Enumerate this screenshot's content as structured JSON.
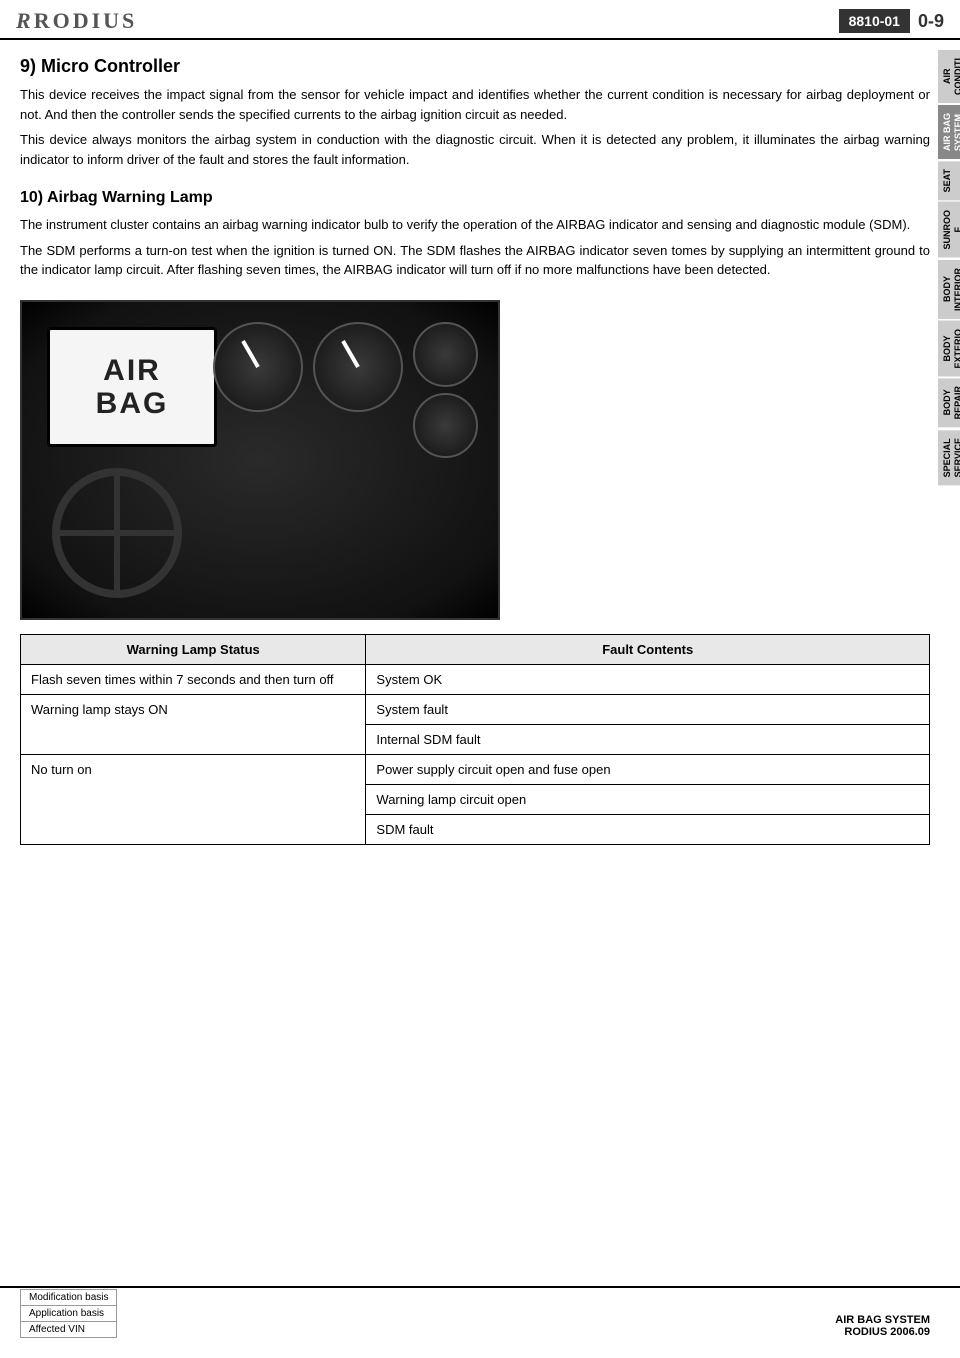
{
  "header": {
    "logo": "RODIUS",
    "page_code": "8810-01",
    "page_num": "0-9"
  },
  "sidebar": {
    "tabs": [
      {
        "id": "air-condio",
        "label": "AIR\nCONDITIO",
        "active": false
      },
      {
        "id": "air-bag",
        "label": "AIR BAG\nSYSTEM",
        "active": true
      },
      {
        "id": "seat",
        "label": "SEAT",
        "active": false
      },
      {
        "id": "sunroof",
        "label": "SUNROO\nF",
        "active": false
      },
      {
        "id": "body-interior",
        "label": "BODY\nINTERIOR",
        "active": false
      },
      {
        "id": "body-exterior",
        "label": "BODY\nEXTERIO",
        "active": false
      },
      {
        "id": "body-repair",
        "label": "BODY\nREPAIR",
        "active": false
      },
      {
        "id": "special-service",
        "label": "SPECIAL\nSERVICE",
        "active": false
      }
    ]
  },
  "sections": {
    "micro_controller": {
      "heading": "9) Micro Controller",
      "paragraphs": [
        "This device receives the impact signal from the sensor for vehicle impact and identifies whether the current condition is necessary for airbag deployment or not. And then the controller sends the specified currents to the airbag ignition circuit as needed.",
        "This device always monitors the airbag system in conduction with the diagnostic circuit. When it is detected any problem, it illuminates the airbag warning indicator to inform driver of the fault and stores the fault information."
      ]
    },
    "warning_lamp": {
      "heading": "10) Airbag Warning Lamp",
      "paragraphs": [
        "The instrument cluster contains an airbag warning indicator bulb to verify the operation of the AIRBAG indicator and sensing and diagnostic module (SDM).",
        "The SDM performs a turn-on test when the ignition is turned ON. The SDM flashes the AIRBAG indicator seven tomes by supplying an intermittent ground to the indicator lamp circuit. After flashing seven times, the AIRBAG indicator will turn off if no more malfunctions have been detected."
      ]
    }
  },
  "dashboard": {
    "airbag_label_line1": "AIR",
    "airbag_label_line2": "BAG"
  },
  "table": {
    "col1_header": "Warning Lamp Status",
    "col2_header": "Fault Contents",
    "rows": [
      {
        "status": "Flash seven times within 7 seconds and then turn off",
        "faults": [
          "System  OK"
        ]
      },
      {
        "status": "Warning lamp stays ON",
        "faults": [
          "System  fault",
          "Internal SDM fault"
        ]
      },
      {
        "status": "No turn on",
        "faults": [
          "Power supply circuit open and fuse open",
          "Warning lamp circuit open",
          "SDM  fault"
        ]
      }
    ]
  },
  "footer": {
    "labels": [
      "Modification basis",
      "Application basis",
      "Affected VIN"
    ],
    "system_name": "AIR BAG SYSTEM",
    "doc_ref": "RODIUS 2006.09"
  }
}
